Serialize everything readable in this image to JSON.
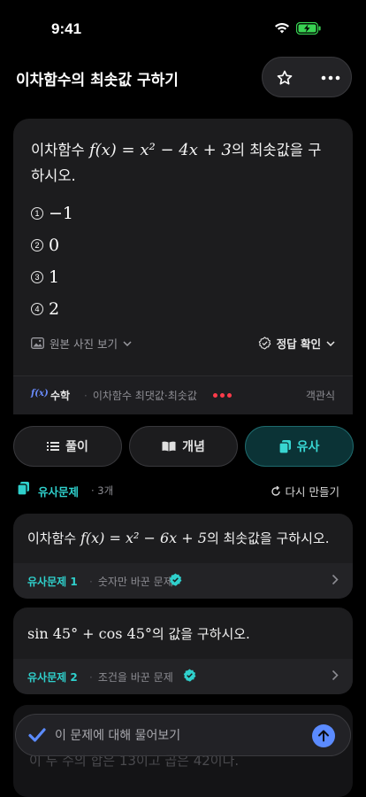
{
  "status_bar": {
    "time": "9:41"
  },
  "header": {
    "title": "이차함수의 최솟값 구하기"
  },
  "question": {
    "text_prefix": "이차함수 ",
    "formula": "f(x) = x² − 4x + 3",
    "text_suffix": "의 최솟값을 구하시오.",
    "options": [
      {
        "num": "1",
        "value": "−1"
      },
      {
        "num": "2",
        "value": "0"
      },
      {
        "num": "3",
        "value": "1"
      },
      {
        "num": "4",
        "value": "2"
      }
    ],
    "view_original_label": "원본 사진 보기",
    "check_answer_label": "정답 확인",
    "subject_icon": "f(x)",
    "subject": "수학",
    "topic": "이차함수 최댓값·최솟값",
    "type": "객관식"
  },
  "tabs": [
    {
      "label": "풀이",
      "icon": "list-icon"
    },
    {
      "label": "개념",
      "icon": "book-icon"
    },
    {
      "label": "유사",
      "icon": "copy-icon",
      "active": true
    }
  ],
  "similar": {
    "title": "유사문제",
    "count": "· 3개",
    "remake_label": "다시 만들기",
    "items": [
      {
        "text_prefix": "이차함수 ",
        "formula": "f(x) = x² − 6x + 5",
        "text_suffix": "의 최솟값을 구하시오.",
        "label": "유사문제 1",
        "desc": "숫자만 바꾼 문제"
      },
      {
        "text_prefix": "",
        "formula": "sin 45° + cos 45°",
        "text_suffix": "의 값을 구하시오.",
        "label": "유사문제 2",
        "desc": "조건을 바꾼 문제"
      }
    ],
    "partial_item_text": "이 두 수의 합은 13이고 곱은 42이다."
  },
  "ask_bar": {
    "placeholder": "이 문제에 대해 물어보기"
  },
  "colors": {
    "accent": "#2fd0cc",
    "send": "#5b8bff",
    "dots": "#ff3b4a"
  }
}
